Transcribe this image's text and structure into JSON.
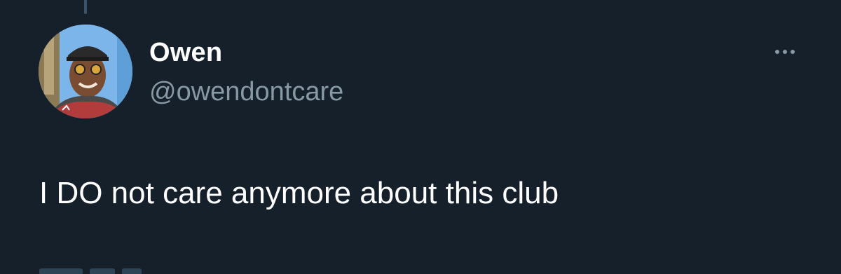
{
  "tweet": {
    "author": {
      "display_name": "Owen",
      "handle": "@owendontcare",
      "avatar_icon": "profile-photo"
    },
    "text": "I DO not care anymore about this club",
    "more_icon": "more-options-icon"
  },
  "colors": {
    "background": "#15202b",
    "primary_text": "#ffffff",
    "secondary_text": "#8899a6",
    "thread_line": "#3d5466"
  }
}
